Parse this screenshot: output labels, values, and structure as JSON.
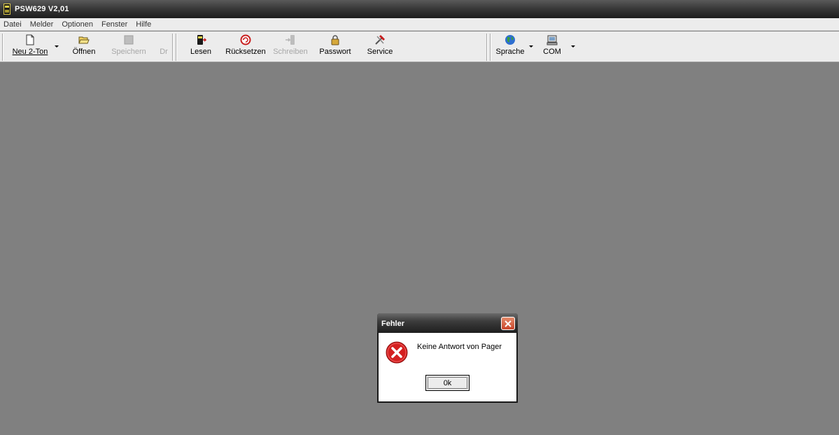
{
  "window": {
    "title": "PSW629 V2,01"
  },
  "menu": [
    "Datei",
    "Melder",
    "Optionen",
    "Fenster",
    "Hilfe"
  ],
  "toolbar": {
    "new": {
      "label": "Neu 2-Ton",
      "icon": "new-document-icon"
    },
    "open": {
      "label": "Öffnen",
      "icon": "open-folder-icon"
    },
    "save": {
      "label": "Speichern",
      "icon": "save-disk-icon",
      "disabled": true
    },
    "print": {
      "label": "Dr",
      "icon": "print-icon",
      "disabled": true
    },
    "read": {
      "label": "Lesen",
      "icon": "read-device-icon"
    },
    "reset": {
      "label": "Rücksetzen",
      "icon": "reset-icon"
    },
    "write": {
      "label": "Schreiben",
      "icon": "write-device-icon",
      "disabled": true
    },
    "password": {
      "label": "Passwort",
      "icon": "padlock-icon"
    },
    "service": {
      "label": "Service",
      "icon": "service-icon"
    },
    "language": {
      "label": "Sprache",
      "icon": "globe-icon"
    },
    "com": {
      "label": "COM",
      "icon": "com-port-icon"
    }
  },
  "dialog": {
    "title": "Fehler",
    "message": "Keine Antwort von Pager",
    "ok_label": "0k",
    "icon": "error-icon"
  },
  "colors": {
    "workspace": "#808080",
    "titlebar": "#2a2a2a",
    "toolbar": "#ececec",
    "error_red": "#d42020"
  }
}
